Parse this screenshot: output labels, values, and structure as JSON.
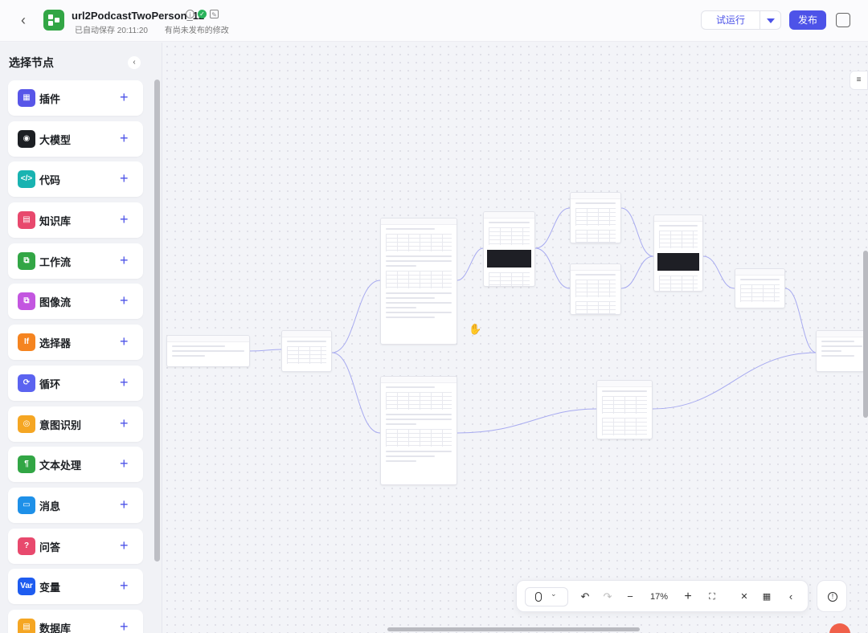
{
  "header": {
    "title": "url2PodcastTwoPerson_12",
    "autosave": "已自动保存 20:11:20",
    "unpublished": "有尚未发布的修改",
    "test_run_label": "试运行",
    "publish_label": "发布"
  },
  "sidebar": {
    "title": "选择节点",
    "items": [
      {
        "label": "插件",
        "icon": "plugin-icon",
        "color": "#5856e8",
        "glyph": "▦"
      },
      {
        "label": "大模型",
        "icon": "llm-icon",
        "color": "#1c1f23",
        "glyph": "◉"
      },
      {
        "label": "代码",
        "icon": "code-icon",
        "color": "#19b3b1",
        "glyph": "</>"
      },
      {
        "label": "知识库",
        "icon": "knowledge-icon",
        "color": "#e8496d",
        "glyph": "▤"
      },
      {
        "label": "工作流",
        "icon": "workflow-icon",
        "color": "#32a645",
        "glyph": "⧉"
      },
      {
        "label": "图像流",
        "icon": "imageflow-icon",
        "color": "#c356e0",
        "glyph": "⧉"
      },
      {
        "label": "选择器",
        "icon": "selector-icon",
        "color": "#f58420",
        "glyph": "If"
      },
      {
        "label": "循环",
        "icon": "loop-icon",
        "color": "#5b63f0",
        "glyph": "⟳"
      },
      {
        "label": "意图识别",
        "icon": "intent-icon",
        "color": "#f5a623",
        "glyph": "◎"
      },
      {
        "label": "文本处理",
        "icon": "text-icon",
        "color": "#32a645",
        "glyph": "¶"
      },
      {
        "label": "消息",
        "icon": "message-icon",
        "color": "#1e90e8",
        "glyph": "▭"
      },
      {
        "label": "问答",
        "icon": "qa-icon",
        "color": "#e8496d",
        "glyph": "?"
      },
      {
        "label": "变量",
        "icon": "variable-icon",
        "color": "#1e5cf0",
        "glyph": "Var"
      },
      {
        "label": "数据库",
        "icon": "database-icon",
        "color": "#f5a623",
        "glyph": "▤"
      }
    ]
  },
  "toolbar": {
    "zoom": "17%"
  },
  "colors": {
    "accent": "#4d53e8",
    "edge": "#a7aaf0"
  }
}
